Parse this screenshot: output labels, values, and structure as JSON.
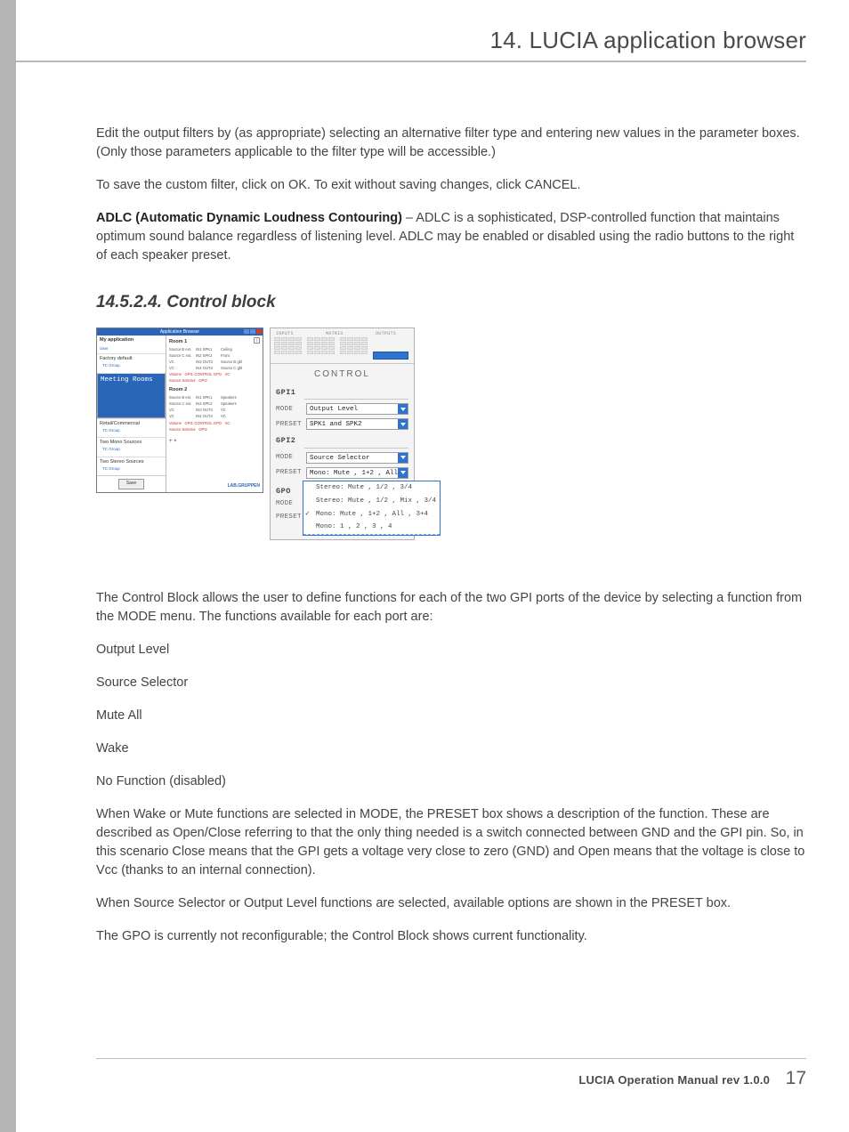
{
  "header": {
    "title": "14. LUCIA application browser"
  },
  "body": {
    "p1": "Edit the output filters by (as appropriate) selecting an alternative filter type and entering new values in the parameter boxes. (Only those parameters applicable to the filter type will be accessible.)",
    "p2": "To save the custom filter, click on OK. To exit without saving changes, click CANCEL.",
    "p3_bold": "ADLC (Automatic Dynamic Loudness Contouring)",
    "p3_rest": " – ADLC is a sophisticated, DSP-controlled function that maintains optimum sound balance regardless of listening level. ADLC may be enabled or disabled using the radio buttons to the right of each speaker preset.",
    "section_heading": "14.5.2.4. Control block",
    "p4": "The Control Block allows the user to define functions for each of the two GPI ports of the device by selecting a function from the MODE menu. The functions available for each port are:",
    "list": [
      "Output Level",
      "Source Selector",
      "Mute All",
      "Wake",
      "No Function (disabled)"
    ],
    "p5": "When Wake or Mute functions are selected in MODE, the PRESET box shows a description of the function. These are described as Open/Close referring to that the only thing needed is a switch connected between GND and the GPI pin. So, in this scenario Close means that the GPI gets a voltage very close to zero (GND) and Open means that the voltage is close to Vcc (thanks to an internal connection).",
    "p6": "When Source Selector or Output Level functions are selected, available options are shown in the PRESET box.",
    "p7": "The GPO is currently not reconfigurable; the Control Block shows current functionality."
  },
  "figure": {
    "app_browser": {
      "window_title": "Application Browser",
      "left": {
        "my_app": "My application",
        "my_app_sub": "User",
        "items": [
          {
            "title": "Factory default",
            "sub": "TC Group"
          },
          {
            "title": "Meeting Rooms",
            "sub": "",
            "selected": true
          },
          {
            "title": "Retail/Commercial",
            "sub": "TC Group"
          },
          {
            "title": "Two Mono Sources",
            "sub": "TC Group"
          },
          {
            "title": "Two Stereo Sources",
            "sub": "TC Group"
          }
        ],
        "save": "Save"
      },
      "rooms": {
        "room1_label": "Room 1",
        "room2_label": "Room 2",
        "cols_left": [
          "Source B ext.",
          "Source C ext.",
          "VC",
          "VC",
          "Volume",
          "Source Selector"
        ],
        "cols_mid_a": [
          "IN1",
          "IN2",
          "IN3",
          "IN4",
          "GPI1",
          "GPI2"
        ],
        "cols_mid_b": [
          "SPK1",
          "SPK2",
          "OUT3",
          "OUT4",
          "GPO",
          ""
        ],
        "cols_right1": [
          "Ceiling",
          "Front",
          "Source B gbl",
          "Source C gbl",
          "VC",
          ""
        ],
        "cols_right2": [
          "Speakers",
          "Speakers",
          "VC",
          "VC",
          "VC",
          ""
        ],
        "gpi_control": "CONTROL",
        "plusx": "+  ×",
        "logo": "LAB.GRUPPEN",
        "info": "i"
      }
    },
    "control_panel": {
      "io_labels": [
        "INPUTS",
        "MATRIX",
        "OUTPUTS"
      ],
      "heading": "CONTROL",
      "gpi1": {
        "label": "GPI1",
        "mode_lbl": "MODE",
        "mode_val": "Output Level",
        "preset_lbl": "PRESET",
        "preset_val": "SPK1 and SPK2"
      },
      "gpi2": {
        "label": "GPI2",
        "mode_lbl": "MODE",
        "mode_val": "Source Selector",
        "preset_lbl": "PRESET",
        "preset_val": "Mono: Mute , 1+2 , All , 3+4"
      },
      "gpo": {
        "label": "GPO",
        "mode_lbl": "MODE",
        "preset_lbl": "PRESET"
      },
      "dropdown": [
        {
          "text": "Stereo: Mute , 1/2 , 3/4",
          "checked": false
        },
        {
          "text": "Stereo: Mute , 1/2 , Mix , 3/4",
          "checked": false
        },
        {
          "text": "Mono: Mute , 1+2 , All , 3+4",
          "checked": true
        },
        {
          "text": "Mono: 1 , 2 , 3 , 4",
          "checked": false
        }
      ]
    }
  },
  "footer": {
    "doc": "LUCIA Operation Manual  rev 1.0.0",
    "page": "17"
  }
}
